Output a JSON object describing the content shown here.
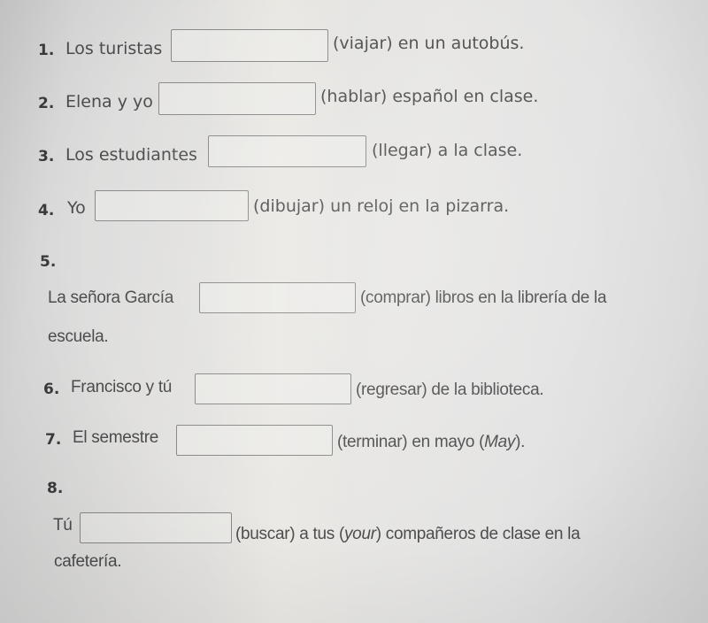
{
  "exercise": {
    "items": [
      {
        "number": "1.",
        "subject": "Los turistas",
        "answer": "",
        "verb": "(viajar)",
        "rest": "en un autobús."
      },
      {
        "number": "2.",
        "subject": "Elena y yo",
        "answer": "",
        "verb": "(hablar)",
        "rest": "español en clase."
      },
      {
        "number": "3.",
        "subject": "Los estudiantes",
        "answer": "",
        "verb": "(llegar)",
        "rest": "a la clase."
      },
      {
        "number": "4.",
        "subject": "Yo",
        "answer": "",
        "verb": "(dibujar)",
        "rest": "un reloj en la pizarra."
      },
      {
        "number": "5.",
        "subject": "La señora García",
        "answer": "",
        "verb": "(comprar)",
        "rest": "libros en la librería de la",
        "continuation": "escuela."
      },
      {
        "number": "6.",
        "subject": "Francisco y tú",
        "answer": "",
        "verb": "(regresar)",
        "rest": "de la biblioteca."
      },
      {
        "number": "7.",
        "subject": "El semestre",
        "answer": "",
        "verb": "(terminar)",
        "rest": "en mayo (",
        "rest_italic": "May",
        "rest_end": ")."
      },
      {
        "number": "8.",
        "subject": "Tú",
        "answer": "",
        "verb": "(buscar)",
        "rest": "a tus (",
        "rest_italic": "your",
        "rest_end": ") compañeros de clase en la",
        "continuation": "cafetería."
      }
    ]
  }
}
